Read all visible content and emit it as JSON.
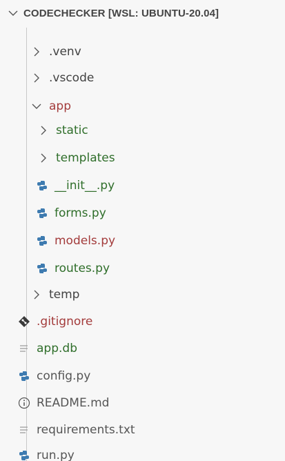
{
  "explorer": {
    "title": "CODECHECKER [WSL: UBUNTU-20.04]",
    "colors": {
      "background": "#f7f7f7",
      "folder_app": "#a33b3b",
      "modified_green": "#2f6e2a",
      "python_icon": "#3e7bb0"
    },
    "items": [
      {
        "label": ".venv",
        "icon": "chevron-right-icon"
      },
      {
        "label": ".vscode",
        "icon": "chevron-right-icon"
      },
      {
        "label": "app",
        "icon": "chevron-down-icon"
      },
      {
        "label": "static",
        "icon": "chevron-right-icon"
      },
      {
        "label": "templates",
        "icon": "chevron-right-icon"
      },
      {
        "label": "__init__.py",
        "icon": "python-icon"
      },
      {
        "label": "forms.py",
        "icon": "python-icon"
      },
      {
        "label": "models.py",
        "icon": "python-icon"
      },
      {
        "label": "routes.py",
        "icon": "python-icon"
      },
      {
        "label": "temp",
        "icon": "chevron-right-icon"
      },
      {
        "label": ".gitignore",
        "icon": "git-icon"
      },
      {
        "label": "app.db",
        "icon": "lines-icon"
      },
      {
        "label": "config.py",
        "icon": "python-icon"
      },
      {
        "label": "README.md",
        "icon": "info-icon"
      },
      {
        "label": "requirements.txt",
        "icon": "lines-icon"
      },
      {
        "label": "run.py",
        "icon": "python-icon"
      }
    ]
  }
}
